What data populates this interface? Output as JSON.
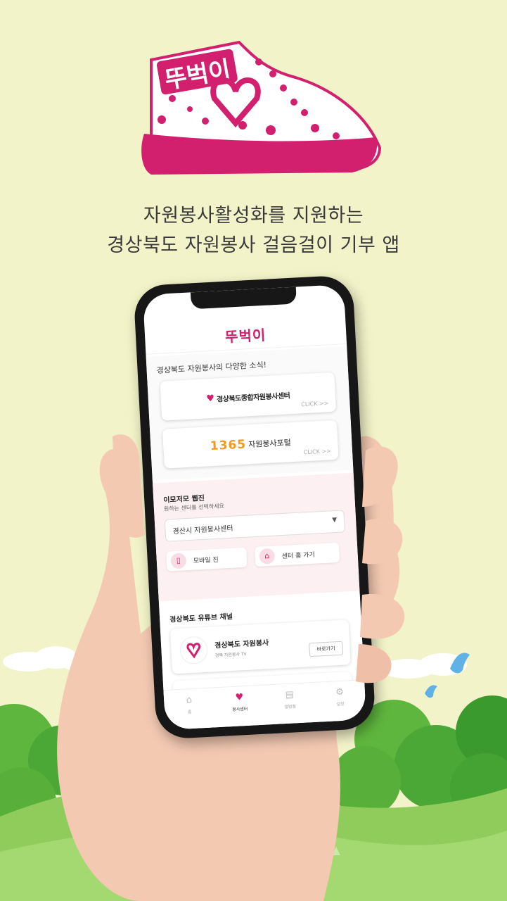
{
  "colors": {
    "background": "#f3f3c9",
    "brand_pink": "#d21f6e",
    "orange_1365": "#f29a1e"
  },
  "logo": {
    "text": "뚜벅이"
  },
  "headline": {
    "line1": "자원봉사활성화를 지원하는",
    "line2": "경상북도 자원봉사 걸음걸이 기부 앱"
  },
  "app": {
    "header_title": "뚜벅이",
    "news": {
      "title": "경상북도 자원봉사의 다양한 소식!",
      "cards": [
        {
          "name": "경상북도종합자원봉사센터",
          "click": "CLICK >>"
        },
        {
          "number": "1365",
          "name": "자원봉사포털",
          "click": "CLICK >>"
        }
      ]
    },
    "ezine": {
      "title": "이모저모 웹진",
      "subtitle": "원하는 센터를 선택하세요",
      "select_value": "경산시 자원봉사센터",
      "buttons": [
        {
          "label": "모바일 진",
          "icon": "phone-icon"
        },
        {
          "label": "센터 홈 가기",
          "icon": "home-icon"
        }
      ]
    },
    "youtube": {
      "title": "경상북도 유튜브 채널",
      "channel_name": "경상북도 자원봉사",
      "channel_sub": "경북 자원봉사 TV",
      "go_label": "바로가기"
    },
    "tabs": [
      {
        "label": "홈",
        "icon": "home-icon"
      },
      {
        "label": "봉사센터",
        "icon": "heart-icon",
        "active": true
      },
      {
        "label": "앨범철",
        "icon": "album-icon"
      },
      {
        "label": "설정",
        "icon": "gear-icon"
      }
    ]
  }
}
